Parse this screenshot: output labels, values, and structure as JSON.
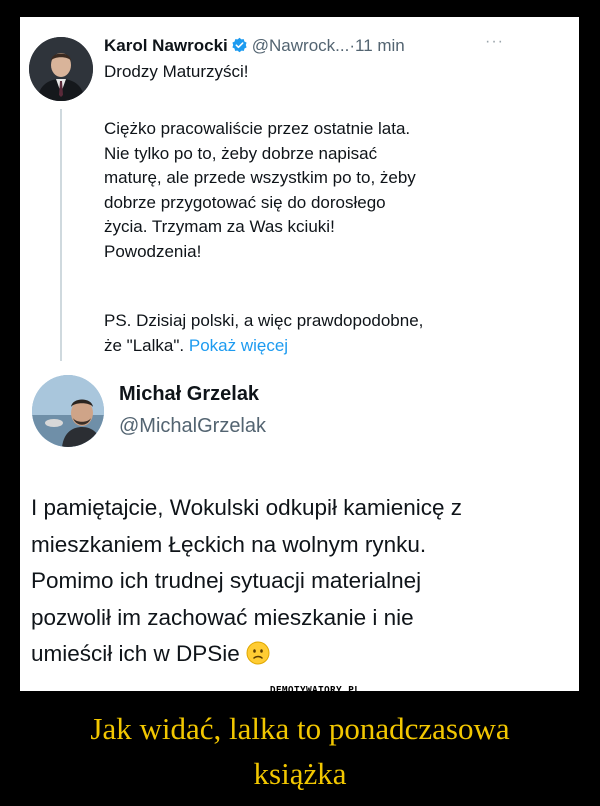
{
  "tweet1": {
    "author_name": "Karol Nawrocki",
    "handle": "@Nawrock...",
    "separator": "·",
    "time": "11 min",
    "more": "···",
    "first_line": "Drodzy Maturzyści!",
    "body_lines": [
      "Ciężko pracowaliście przez ostatnie lata.",
      "Nie tylko po to, żeby dobrze napisać",
      "maturę, ale przede wszystkim po to, żeby",
      "dobrze przygotować się do dorosłego",
      "życia. Trzymam za Was kciuki!",
      "Powodzenia!"
    ],
    "ps_line1": "PS. Dzisiaj polski, a więc prawdopodobne,",
    "ps_line2": "że \"Lalka\".",
    "show_more": "Pokaż więcej"
  },
  "tweet2": {
    "author_name": "Michał Grzelak",
    "handle": "@MichalGrzelak",
    "body_lines": [
      "I pamiętajcie, Wokulski odkupił kamienicę z",
      "mieszkaniem Łęckich na wolnym rynku.",
      "Pomimo ich trudnej sytuacji materialnej",
      "pozwolił im zachować mieszkanie i nie",
      "umieścił ich w DPSie"
    ],
    "emoji": "slightly-frowning-face"
  },
  "watermark": "DEMOTYWATORY.PL",
  "caption_lines": [
    "Jak widać, lalka to ponadczasowa",
    "książka"
  ],
  "colors": {
    "link": "#1d9bf0",
    "verified": "#1d9bf0",
    "caption": "#f2c700",
    "background": "#000000"
  }
}
